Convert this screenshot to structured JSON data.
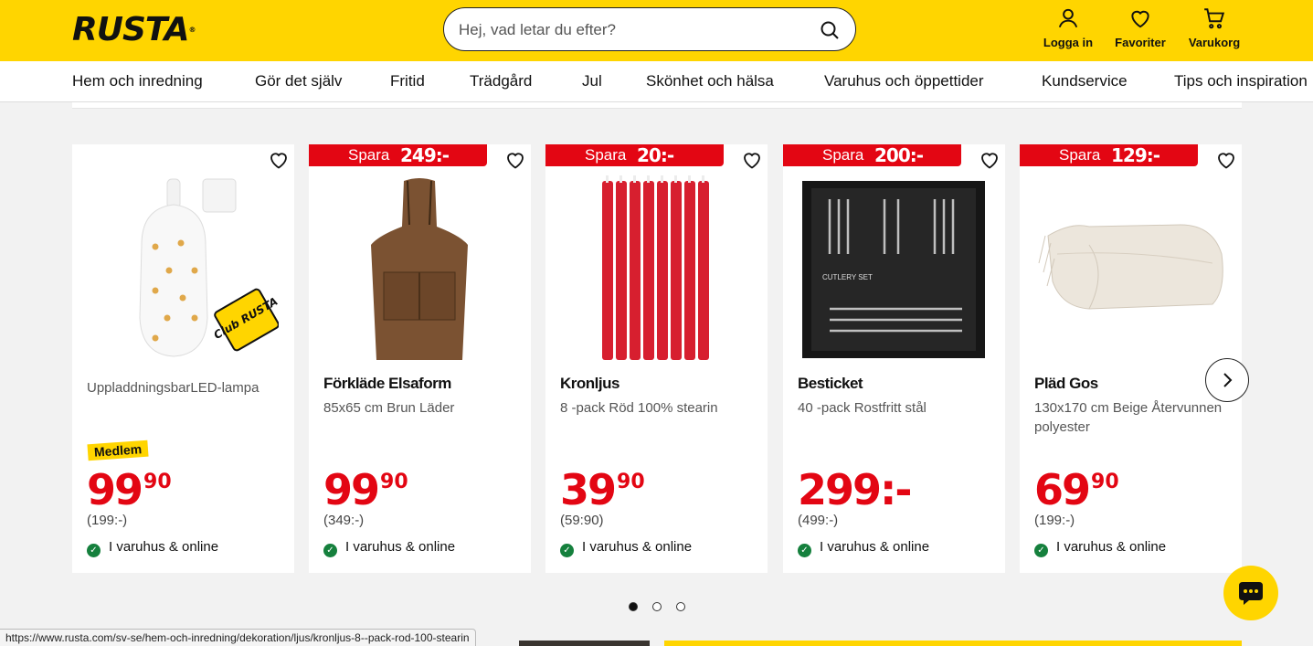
{
  "header": {
    "logo": "RUSTA",
    "logo_mark": "®",
    "search_placeholder": "Hej, vad letar du efter?",
    "login_label": "Logga in",
    "favorites_label": "Favoriter",
    "cart_label": "Varukorg"
  },
  "nav": [
    "Hem och inredning",
    "Gör det själv",
    "Fritid",
    "Trädgård",
    "Jul",
    "Skönhet och hälsa",
    "Varuhus och öppettider",
    "Kundservice",
    "Tips och inspiration"
  ],
  "products": [
    {
      "name": "",
      "description": "UppladdningsbarLED-lampa",
      "member_label": "Medlem",
      "price_main": "99",
      "price_dec": "90",
      "ordinary": "(199:-)",
      "stock": "I varuhus & online",
      "club_badge": "Club RUSTA",
      "image_icon": "led-lamp-image"
    },
    {
      "badge_label": "Spara",
      "badge_amount": "249:-",
      "name": "Förkläde Elsaform",
      "description": "85x65 cm Brun Läder",
      "price_main": "99",
      "price_dec": "90",
      "ordinary": "(349:-)",
      "stock": "I varuhus & online",
      "image_icon": "leather-apron-image"
    },
    {
      "badge_label": "Spara",
      "badge_amount": "20:-",
      "name": "Kronljus",
      "description": "8 -pack Röd 100% stearin",
      "price_main": "39",
      "price_dec": "90",
      "ordinary": "(59:90)",
      "stock": "I varuhus & online",
      "image_icon": "red-candles-image"
    },
    {
      "badge_label": "Spara",
      "badge_amount": "200:-",
      "name": "Besticket",
      "description": "40 -pack Rostfritt stål",
      "price_main": "299:-",
      "price_dec": "",
      "ordinary": "(499:-)",
      "stock": "I varuhus & online",
      "image_text": "CUTLERY SET",
      "image_icon": "cutlery-set-image"
    },
    {
      "badge_label": "Spara",
      "badge_amount": "129:-",
      "name": "Pläd Gos",
      "description": "130x170 cm Beige Återvunnen polyester",
      "price_main": "69",
      "price_dec": "90",
      "ordinary": "(199:-)",
      "stock": "I varuhus & online",
      "image_icon": "beige-blanket-image"
    }
  ],
  "carousel": {
    "pages": 3,
    "active_page": 1
  },
  "status_url": "https://www.rusta.com/sv-se/hem-och-inredning/dekoration/ljus/kronljus-8--pack-rod-100-stearin",
  "colors": {
    "brand_yellow": "#ffd500",
    "sale_red": "#e30613",
    "stock_green": "#15803d"
  }
}
